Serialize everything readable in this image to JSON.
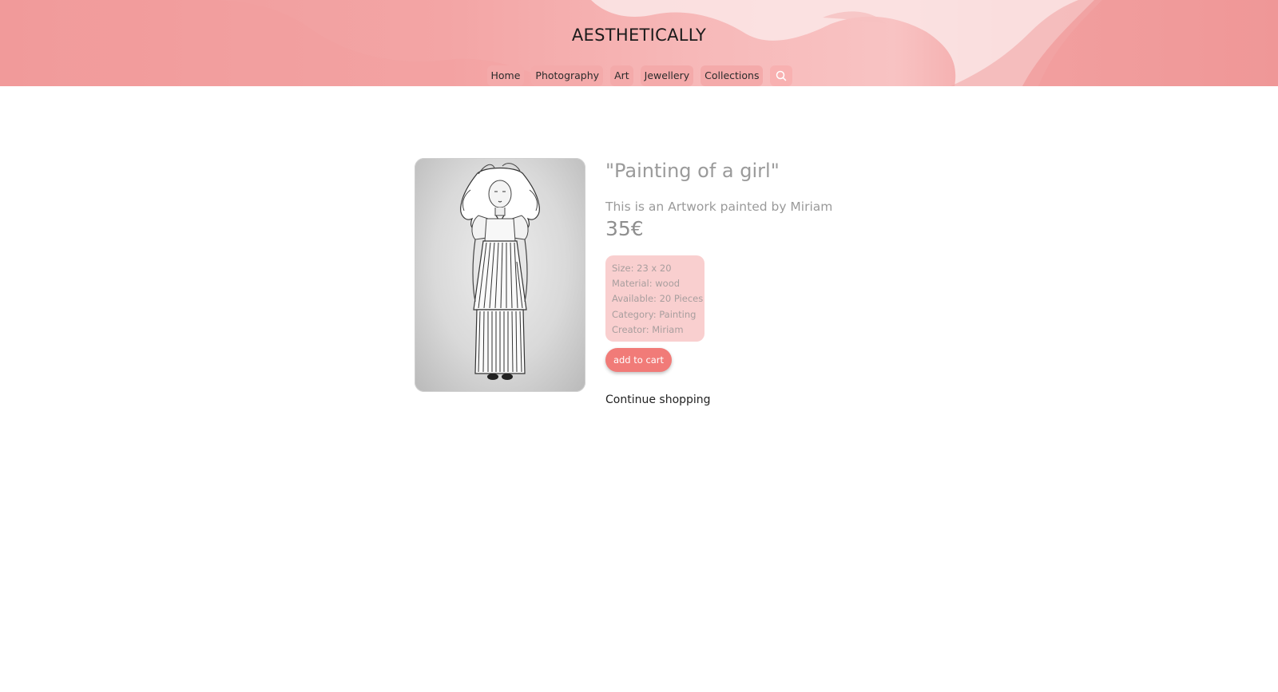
{
  "header": {
    "brand": "AESTHETICALLY",
    "nav": [
      {
        "label": "Home"
      },
      {
        "label": "Photography"
      },
      {
        "label": "Art"
      },
      {
        "label": "Jewellery"
      },
      {
        "label": "Collections"
      }
    ],
    "search_icon": "search-icon"
  },
  "product": {
    "title": "\"Painting of a girl\"",
    "description": "This is an Artwork painted by Miriam",
    "price": "35€",
    "details": [
      "Size: 23 x 20",
      "Material: wood",
      "Available: 20 Pieces",
      "Category: Painting",
      "Creator: Miriam"
    ],
    "add_to_cart_label": "add to cart",
    "continue_label": "Continue shopping"
  },
  "colors": {
    "header_pink": "#f3a5a5",
    "nav_pill": "#f4aaaa",
    "details_bg": "#f9cfcf",
    "accent_button": "#f17b78",
    "muted_text": "#9a9a9a"
  }
}
